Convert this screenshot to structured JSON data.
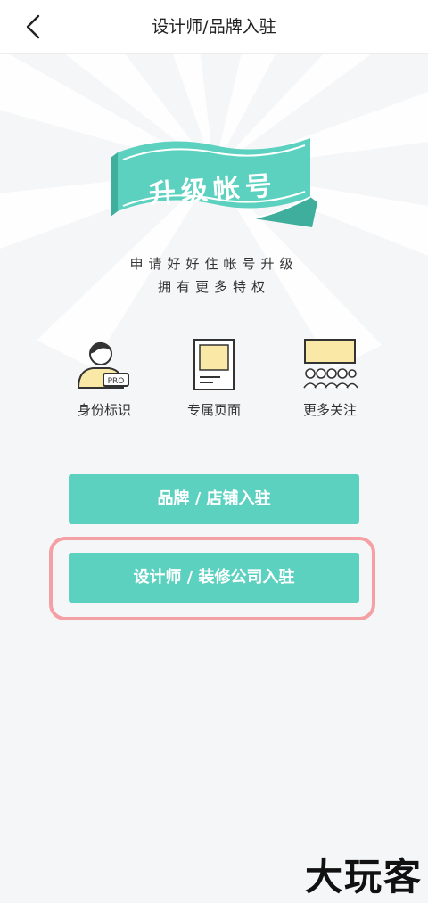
{
  "header": {
    "title": "设计师/品牌入驻"
  },
  "hero": {
    "banner_text": "升级帐号",
    "tagline_1": "申请好好住帐号升级",
    "tagline_2": "拥有更多特权"
  },
  "features": [
    {
      "label": "身份标识",
      "icon": "pro-badge-user-icon",
      "badge": "PRO"
    },
    {
      "label": "专属页面",
      "icon": "page-icon"
    },
    {
      "label": "更多关注",
      "icon": "audience-icon"
    }
  ],
  "buttons": {
    "brand": "品牌 / 店铺入驻",
    "designer": "设计师 / 装修公司入驻"
  },
  "watermark": "大玩客",
  "colors": {
    "accent": "#5cd1bf",
    "accent_dark": "#3fae9c",
    "highlight": "#f4a0a4",
    "icon_fill": "#fae8a6"
  }
}
